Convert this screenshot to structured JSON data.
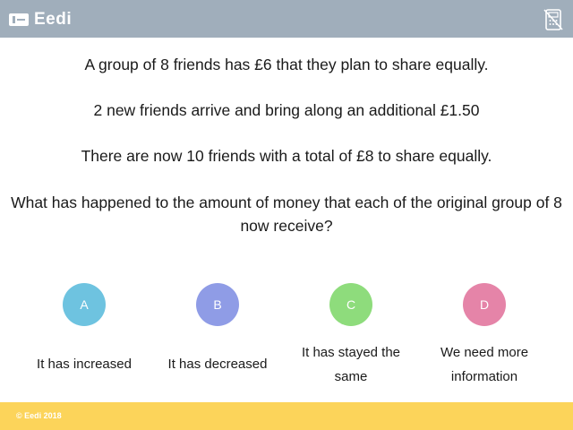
{
  "header": {
    "logo_text": "Eedi",
    "calculator_icon": "calculator-crossed-icon",
    "background": "#a0aebb"
  },
  "question": {
    "line1": "A group of 8 friends has £6 that they plan to share equally.",
    "line2": "2 new friends arrive and bring along an additional £1.50",
    "line3": "There are now 10 friends with a total of £8 to share equally.",
    "line4": "What has happened to the amount of money that each of the original group of 8 now receive?"
  },
  "options": [
    {
      "letter": "A",
      "text": "It has increased",
      "color": "#6ec3e0"
    },
    {
      "letter": "B",
      "text": "It has decreased",
      "color": "#8f9ce6"
    },
    {
      "letter": "C",
      "text": "It has stayed the same",
      "color": "#8edc7c"
    },
    {
      "letter": "D",
      "text": "We need more information",
      "color": "#e584a8"
    }
  ],
  "footer": {
    "copyright": "© Eedi 2018",
    "background": "#fcd45a"
  }
}
